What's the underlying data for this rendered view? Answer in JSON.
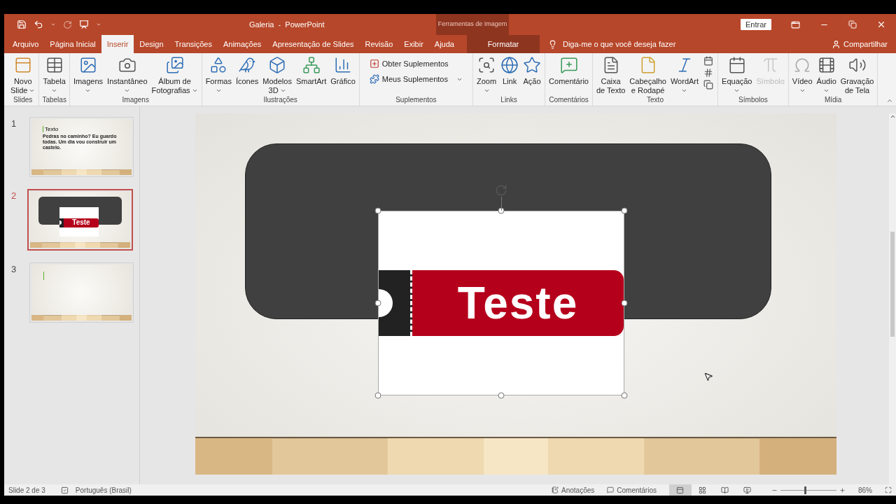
{
  "window": {
    "title": "Galeria  -  PowerPoint",
    "context_group": "Ferramentas de Imagem",
    "sign_in": "Entrar"
  },
  "tabs": [
    {
      "label": "Arquivo",
      "selected": false,
      "kind": "file"
    },
    {
      "label": "Página Inicial",
      "selected": false,
      "kind": "normal"
    },
    {
      "label": "Inserir",
      "selected": true,
      "kind": "normal"
    },
    {
      "label": "Design",
      "selected": false,
      "kind": "normal"
    },
    {
      "label": "Transições",
      "selected": false,
      "kind": "normal"
    },
    {
      "label": "Animações",
      "selected": false,
      "kind": "normal"
    },
    {
      "label": "Apresentação de Slides",
      "selected": false,
      "kind": "normal"
    },
    {
      "label": "Revisão",
      "selected": false,
      "kind": "normal"
    },
    {
      "label": "Exibir",
      "selected": false,
      "kind": "normal"
    },
    {
      "label": "Ajuda",
      "selected": false,
      "kind": "normal"
    },
    {
      "label": "Formatar",
      "selected": false,
      "kind": "context"
    }
  ],
  "tell_me": {
    "placeholder": "Diga-me o que você deseja fazer"
  },
  "share": "Compartilhar",
  "ribbon": [
    {
      "label": "Slides",
      "items": [
        {
          "kind": "large",
          "lines": [
            "Novo",
            "Slide"
          ],
          "caret": true,
          "disabled": false
        }
      ]
    },
    {
      "label": "Tabelas",
      "items": [
        {
          "kind": "large",
          "lines": [
            "Tabela"
          ],
          "caret": true,
          "disabled": false
        }
      ]
    },
    {
      "label": "Imagens",
      "items": [
        {
          "kind": "large",
          "lines": [
            "Imagens"
          ],
          "caret": true,
          "disabled": false
        },
        {
          "kind": "large",
          "lines": [
            "Instantâneo"
          ],
          "caret": true,
          "disabled": false
        },
        {
          "kind": "large",
          "lines": [
            "Álbum de",
            "Fotografias"
          ],
          "caret": true,
          "disabled": false
        }
      ]
    },
    {
      "label": "Ilustrações",
      "items": [
        {
          "kind": "large",
          "lines": [
            "Formas"
          ],
          "caret": true,
          "disabled": false
        },
        {
          "kind": "large",
          "lines": [
            "Ícones"
          ],
          "caret": false,
          "disabled": false
        },
        {
          "kind": "large",
          "lines": [
            "Modelos",
            "3D"
          ],
          "caret": true,
          "disabled": false
        },
        {
          "kind": "large",
          "lines": [
            "SmartArt"
          ],
          "caret": false,
          "disabled": false
        },
        {
          "kind": "large",
          "lines": [
            "Gráfico"
          ],
          "caret": false,
          "disabled": false
        }
      ]
    },
    {
      "label": "Suplementos",
      "items": [
        {
          "kind": "small",
          "lines": [
            "Obter Suplementos"
          ],
          "caret": false,
          "disabled": false
        },
        {
          "kind": "small",
          "lines": [
            "Meus Suplementos"
          ],
          "caret": true,
          "disabled": false
        }
      ]
    },
    {
      "label": "Links",
      "items": [
        {
          "kind": "large",
          "lines": [
            "Zoom"
          ],
          "caret": true,
          "disabled": false
        },
        {
          "kind": "large",
          "lines": [
            "Link"
          ],
          "caret": false,
          "disabled": false
        },
        {
          "kind": "large",
          "lines": [
            "Ação"
          ],
          "caret": false,
          "disabled": false
        }
      ]
    },
    {
      "label": "Comentários",
      "items": [
        {
          "kind": "large",
          "lines": [
            "Comentário"
          ],
          "caret": false,
          "disabled": false
        }
      ]
    },
    {
      "label": "Texto",
      "items": [
        {
          "kind": "large",
          "lines": [
            "Caixa",
            "de Texto"
          ],
          "caret": false,
          "disabled": false
        },
        {
          "kind": "large",
          "lines": [
            "Cabeçalho",
            "e Rodapé"
          ],
          "caret": false,
          "disabled": false
        },
        {
          "kind": "large",
          "lines": [
            "WordArt"
          ],
          "caret": true,
          "disabled": false
        },
        {
          "kind": "icons"
        }
      ]
    },
    {
      "label": "Símbolos",
      "items": [
        {
          "kind": "large",
          "lines": [
            "Equação"
          ],
          "caret": true,
          "disabled": false
        },
        {
          "kind": "large",
          "lines": [
            "Símbolo"
          ],
          "caret": false,
          "disabled": true
        }
      ]
    },
    {
      "label": "Mídia",
      "items": [
        {
          "kind": "large",
          "lines": [
            "Vídeo"
          ],
          "caret": true,
          "disabled": false
        },
        {
          "kind": "large",
          "lines": [
            "Áudio"
          ],
          "caret": true,
          "disabled": false
        },
        {
          "kind": "large",
          "lines": [
            "Gravação",
            "de Tela"
          ],
          "caret": false,
          "disabled": false
        }
      ]
    }
  ],
  "thumbnails": [
    {
      "number": "1",
      "selected": false,
      "kind": "text",
      "title": "Texto",
      "body": "Pedras no caminho? Eu guardo todas. Um dia vou construir um castelo."
    },
    {
      "number": "2",
      "selected": true,
      "kind": "ticket",
      "label": "Teste"
    },
    {
      "number": "3",
      "selected": false,
      "kind": "blank"
    }
  ],
  "slide": {
    "ticket_text": "Teste"
  },
  "status_bar": {
    "slide": "Slide 2 de 3",
    "language": "Português (Brasil)",
    "notes": "Anotações",
    "comments": "Comentários",
    "views": [
      {
        "selected": true
      },
      {
        "selected": false
      },
      {
        "selected": false
      },
      {
        "selected": false
      }
    ],
    "zoom": {
      "level": 0.43,
      "reading": "86%"
    }
  }
}
